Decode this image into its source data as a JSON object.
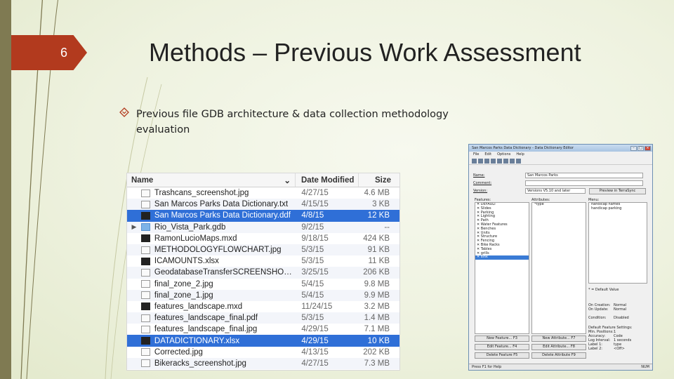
{
  "slide": {
    "number": "6",
    "title": "Methods – Previous Work Assessment",
    "bullet_line1": "Previous file GDB architecture & data collection methodology",
    "bullet_line2": "evaluation"
  },
  "finder": {
    "headers": {
      "name": "Name",
      "date": "Date Modified",
      "size": "Size"
    },
    "rows": [
      {
        "name": "Trashcans_screenshot.jpg",
        "date": "4/27/15",
        "size": "4.6 MB",
        "selected": false,
        "icon": "image-file-icon"
      },
      {
        "name": "San Marcos Parks Data Dictionary.txt",
        "date": "4/15/15",
        "size": "3 KB",
        "selected": false,
        "icon": "text-file-icon"
      },
      {
        "name": "San Marcos Parks Data Dictionary.ddf",
        "date": "4/8/15",
        "size": "12 KB",
        "selected": true,
        "icon": "ddf-file-icon"
      },
      {
        "name": "Rio_Vista_Park.gdb",
        "date": "9/2/15",
        "size": "--",
        "selected": false,
        "icon": "folder-icon"
      },
      {
        "name": "RamonLucioMaps.mxd",
        "date": "9/18/15",
        "size": "424 KB",
        "selected": false,
        "icon": "map-file-icon"
      },
      {
        "name": "METHODOLOGYFLOWCHART.jpg",
        "date": "5/3/15",
        "size": "91 KB",
        "selected": false,
        "icon": "image-file-icon"
      },
      {
        "name": "ICAMOUNTS.xlsx",
        "date": "5/3/15",
        "size": "11 KB",
        "selected": false,
        "icon": "spreadsheet-file-icon"
      },
      {
        "name": "GeodatabaseTransferSCREENSHOT.jpg",
        "date": "3/25/15",
        "size": "206 KB",
        "selected": false,
        "icon": "image-file-icon"
      },
      {
        "name": "final_zone_2.jpg",
        "date": "5/4/15",
        "size": "9.8 MB",
        "selected": false,
        "icon": "image-file-icon"
      },
      {
        "name": "final_zone_1.jpg",
        "date": "5/4/15",
        "size": "9.9 MB",
        "selected": false,
        "icon": "image-file-icon"
      },
      {
        "name": "features_landscape.mxd",
        "date": "11/24/15",
        "size": "3.2 MB",
        "selected": false,
        "icon": "map-file-icon"
      },
      {
        "name": "features_landscape_final.pdf",
        "date": "5/3/15",
        "size": "1.4 MB",
        "selected": false,
        "icon": "pdf-file-icon"
      },
      {
        "name": "features_landscape_final.jpg",
        "date": "4/29/15",
        "size": "7.1 MB",
        "selected": false,
        "icon": "image-file-icon"
      },
      {
        "name": "DATADICTIONARY.xlsx",
        "date": "4/29/15",
        "size": "10 KB",
        "selected": true,
        "icon": "spreadsheet-file-icon"
      },
      {
        "name": "Corrected.jpg",
        "date": "4/13/15",
        "size": "202 KB",
        "selected": false,
        "icon": "image-file-icon"
      },
      {
        "name": "Bikeracks_screenshot.jpg",
        "date": "4/27/15",
        "size": "7.3 MB",
        "selected": false,
        "icon": "image-file-icon"
      }
    ]
  },
  "editor": {
    "title": "San Marcos Parks Data Dictionary - Data Dictionary Editor",
    "menu": [
      "File",
      "Edit",
      "Options",
      "Help"
    ],
    "name_label": "Name:",
    "name_value": "San Marcos Parks",
    "comment_label": "Comment:",
    "comment_value": "",
    "version_label": "Version:",
    "version_value": "Versions V5.10 and later",
    "preview_button": "Preview in TerraSync",
    "features_label": "Features:",
    "features": [
      "DEFAULT",
      "Slides",
      "Parking",
      "Lighting",
      "Path",
      "Water Features",
      "Benches",
      "Units",
      "Structure",
      "Fencing",
      "Bike Racks",
      "Tables",
      "grills",
      "sink"
    ],
    "attributes_label": "Attributes:",
    "attributes": [
      "type"
    ],
    "menu_label": "Menu:",
    "menu_items": [
      "handicap names",
      "handicap parking"
    ],
    "default_note": "* = Default Value",
    "on_creation_label": "On Creation:",
    "on_creation_value": "Normal",
    "on_update_label": "On Update:",
    "on_update_value": "Normal",
    "condition_label": "Condition:",
    "condition_value": "Disabled",
    "default_settings_label": "Default Feature Settings:",
    "settings": [
      {
        "k": "Min. Positions:",
        "v": "1"
      },
      {
        "k": "Accuracy:",
        "v": "Code"
      },
      {
        "k": "Log Interval:",
        "v": "1 seconds"
      },
      {
        "k": "Label 1:",
        "v": "type"
      },
      {
        "k": "Label 2:",
        "v": "<Off>"
      }
    ],
    "new_feature": "New Feature... F3",
    "edit_feature": "Edit Feature... F4",
    "delete_feature": "Delete Feature F5",
    "new_attribute": "New Attribute... F7",
    "edit_attribute": "Edit Attribute... F8",
    "delete_attribute": "Delete Attribute F9",
    "status_left": "Press F1 for Help",
    "status_right": "NUM"
  }
}
